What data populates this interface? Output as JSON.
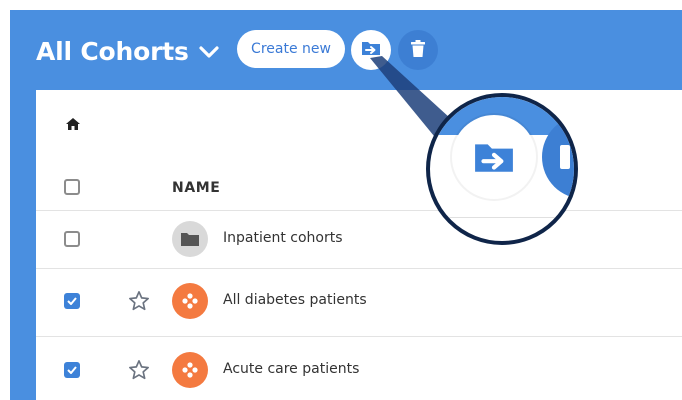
{
  "header": {
    "title": "All Cohorts",
    "create_label": "Create new"
  },
  "table": {
    "col_name": "NAME",
    "rows": [
      {
        "label": "Inpatient cohorts",
        "type": "folder",
        "checked": false,
        "starred": null
      },
      {
        "label": "All diabetes patients",
        "type": "cohort",
        "checked": true,
        "starred": false
      },
      {
        "label": "Acute care patients",
        "type": "cohort",
        "checked": true,
        "starred": false
      }
    ]
  },
  "icons": {
    "title_dropdown": "chevron-down-icon",
    "move": "move-to-folder-icon",
    "delete": "trash-icon",
    "home": "home-icon",
    "folder": "folder-icon",
    "cohort": "cohort-icon",
    "star": "star-outline-icon",
    "magnifier": "magnifier-callout"
  },
  "colors": {
    "header_bg": "#4a8fe0",
    "accent": "#3d82d8",
    "cohort_orange": "#f47a40",
    "zoom_border": "#0f2549"
  }
}
